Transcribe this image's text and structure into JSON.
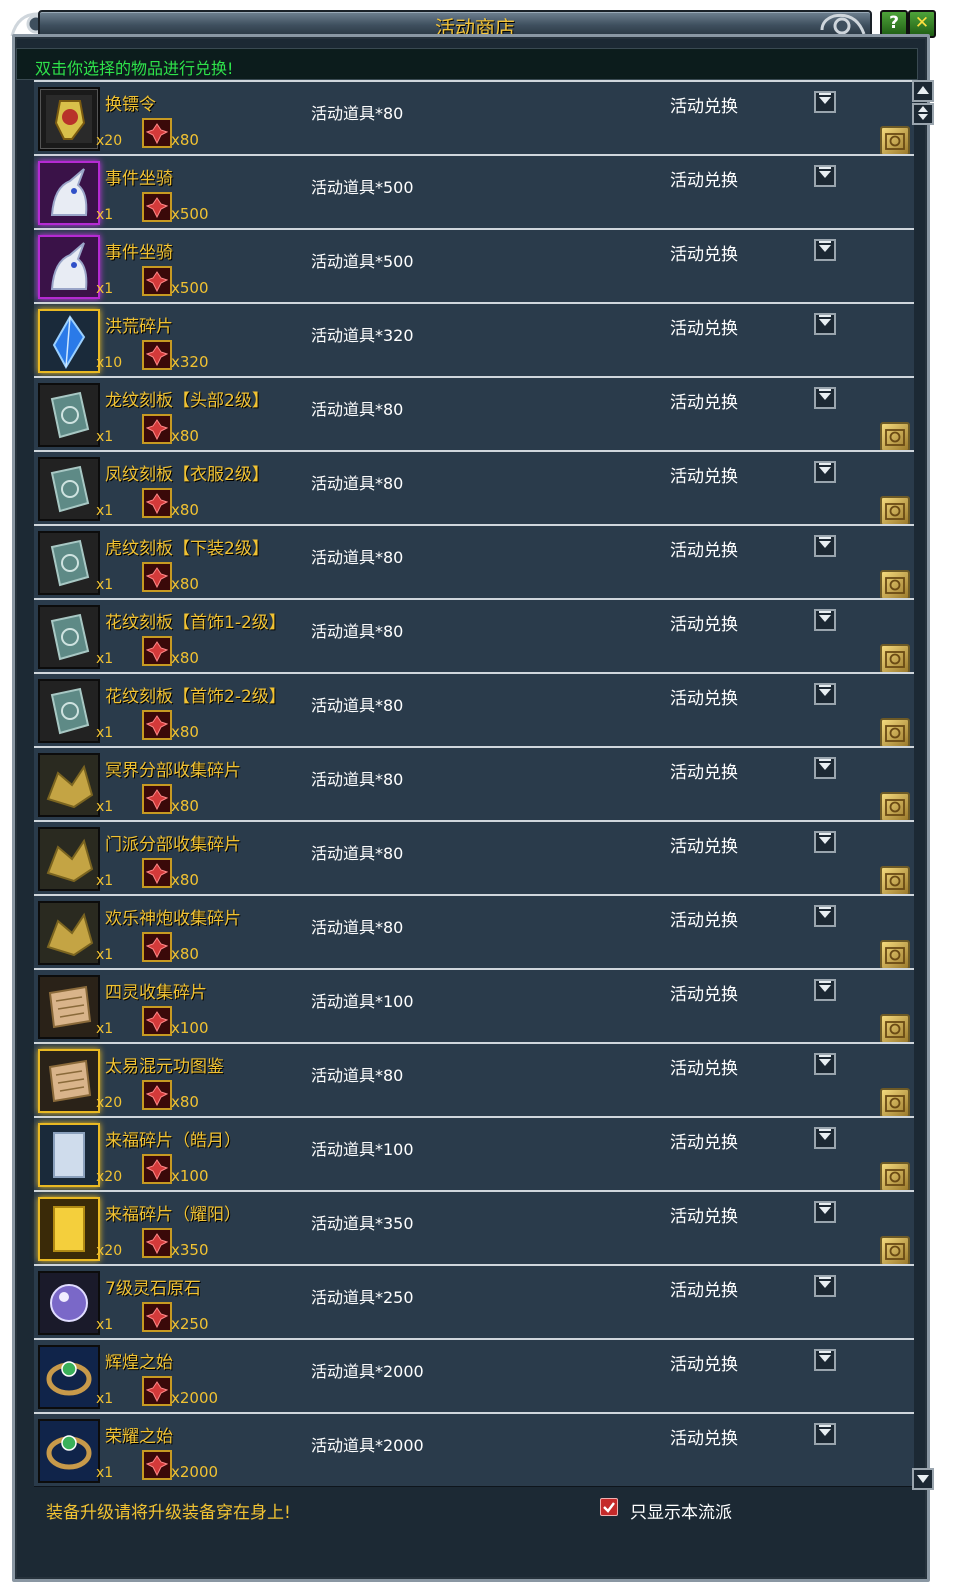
{
  "window": {
    "title": "活动商店",
    "help_label": "?",
    "close_label": "✕"
  },
  "hint": "双击你选择的物品进行兑换!",
  "items": [
    {
      "name": "换镖令",
      "qty": "x20",
      "token_qty": "x80",
      "cost": "活动道具*80",
      "type": "活动兑换",
      "frame": "plain",
      "badge": true,
      "icon": "scroll-token-icon"
    },
    {
      "name": "事件坐骑",
      "qty": "x1",
      "token_qty": "x500",
      "cost": "活动道具*500",
      "type": "活动兑换",
      "frame": "purple",
      "badge": false,
      "icon": "unicorn-mount-icon"
    },
    {
      "name": "事件坐骑",
      "qty": "x1",
      "token_qty": "x500",
      "cost": "活动道具*500",
      "type": "活动兑换",
      "frame": "purple",
      "badge": false,
      "icon": "unicorn-mount-icon"
    },
    {
      "name": "洪荒碎片",
      "qty": "x10",
      "token_qty": "x320",
      "cost": "活动道具*320",
      "type": "活动兑换",
      "frame": "gold",
      "badge": false,
      "icon": "blue-crystal-icon"
    },
    {
      "name": "龙纹刻板【头部2级】",
      "qty": "x1",
      "token_qty": "x80",
      "cost": "活动道具*80",
      "type": "活动兑换",
      "frame": "plain",
      "badge": true,
      "icon": "engraving-plate-icon"
    },
    {
      "name": "凤纹刻板【衣服2级】",
      "qty": "x1",
      "token_qty": "x80",
      "cost": "活动道具*80",
      "type": "活动兑换",
      "frame": "plain",
      "badge": true,
      "icon": "engraving-plate-icon"
    },
    {
      "name": "虎纹刻板【下装2级】",
      "qty": "x1",
      "token_qty": "x80",
      "cost": "活动道具*80",
      "type": "活动兑换",
      "frame": "plain",
      "badge": true,
      "icon": "engraving-plate-icon"
    },
    {
      "name": "花纹刻板【首饰1-2级】",
      "qty": "x1",
      "token_qty": "x80",
      "cost": "活动道具*80",
      "type": "活动兑换",
      "frame": "plain",
      "badge": true,
      "icon": "engraving-plate-icon"
    },
    {
      "name": "花纹刻板【首饰2-2级】",
      "qty": "x1",
      "token_qty": "x80",
      "cost": "活动道具*80",
      "type": "活动兑换",
      "frame": "plain",
      "badge": true,
      "icon": "engraving-plate-icon"
    },
    {
      "name": "冥界分部收集碎片",
      "qty": "x1",
      "token_qty": "x80",
      "cost": "活动道具*80",
      "type": "活动兑换",
      "frame": "plain",
      "badge": true,
      "icon": "fragment-pile-icon"
    },
    {
      "name": "门派分部收集碎片",
      "qty": "x1",
      "token_qty": "x80",
      "cost": "活动道具*80",
      "type": "活动兑换",
      "frame": "plain",
      "badge": true,
      "icon": "fragment-pile-icon"
    },
    {
      "name": "欢乐神炮收集碎片",
      "qty": "x1",
      "token_qty": "x80",
      "cost": "活动道具*80",
      "type": "活动兑换",
      "frame": "plain",
      "badge": true,
      "icon": "fragment-pile-icon"
    },
    {
      "name": "四灵收集碎片",
      "qty": "x1",
      "token_qty": "x100",
      "cost": "活动道具*100",
      "type": "活动兑换",
      "frame": "plain",
      "badge": true,
      "icon": "scroll-fragment-icon"
    },
    {
      "name": "太易混元功图鉴",
      "qty": "x20",
      "token_qty": "x80",
      "cost": "活动道具*80",
      "type": "活动兑换",
      "frame": "gold",
      "badge": true,
      "icon": "scroll-fragment-icon"
    },
    {
      "name": "来福碎片（皓月）",
      "qty": "x20",
      "token_qty": "x100",
      "cost": "活动道具*100",
      "type": "活动兑换",
      "frame": "gold",
      "badge": true,
      "icon": "silver-card-icon"
    },
    {
      "name": "来福碎片（耀阳）",
      "qty": "x20",
      "token_qty": "x350",
      "cost": "活动道具*350",
      "type": "活动兑换",
      "frame": "gold",
      "badge": true,
      "icon": "gold-card-icon"
    },
    {
      "name": "7级灵石原石",
      "qty": "x1",
      "token_qty": "x250",
      "cost": "活动道具*250",
      "type": "活动兑换",
      "frame": "plain",
      "badge": false,
      "icon": "spirit-stone-icon"
    },
    {
      "name": "辉煌之始",
      "qty": "x1",
      "token_qty": "x2000",
      "cost": "活动道具*2000",
      "type": "活动兑换",
      "frame": "plain",
      "badge": false,
      "icon": "ring-icon"
    },
    {
      "name": "荣耀之始",
      "qty": "x1",
      "token_qty": "x2000",
      "cost": "活动道具*2000",
      "type": "活动兑换",
      "frame": "plain",
      "badge": false,
      "icon": "ring-icon"
    }
  ],
  "footer": {
    "notice": "装备升级请将升级装备穿在身上!",
    "checkbox_label": "只显示本流派",
    "checkbox_checked": true
  },
  "colors": {
    "accent_gold": "#f1c232",
    "hint_green": "#2ee24a",
    "row_bg": "#2a3b4b",
    "frame_bg": "#1c2934"
  }
}
